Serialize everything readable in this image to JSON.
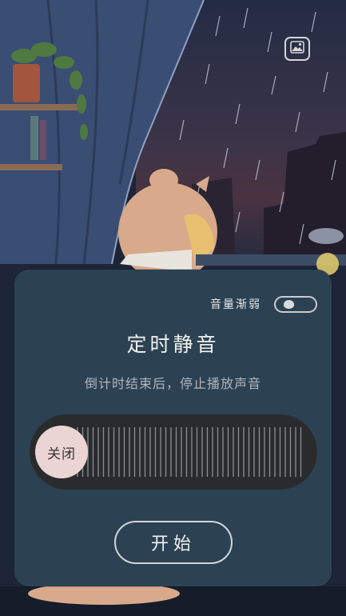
{
  "icons": {
    "gallery": "image-icon"
  },
  "sheet": {
    "fade_label": "音量渐弱",
    "fade_enabled": false,
    "title": "定时静音",
    "subtitle": "倒计时结束后，停止播放声音",
    "slider_value_label": "关闭",
    "slider_level": 0,
    "start_label": "开始"
  },
  "colors": {
    "sheet_bg": "#2c4253",
    "slider_track": "#2a2b2d",
    "slider_thumb": "#ead4d4",
    "text_primary": "#f1f1ef",
    "text_secondary": "#aeb7bf"
  }
}
